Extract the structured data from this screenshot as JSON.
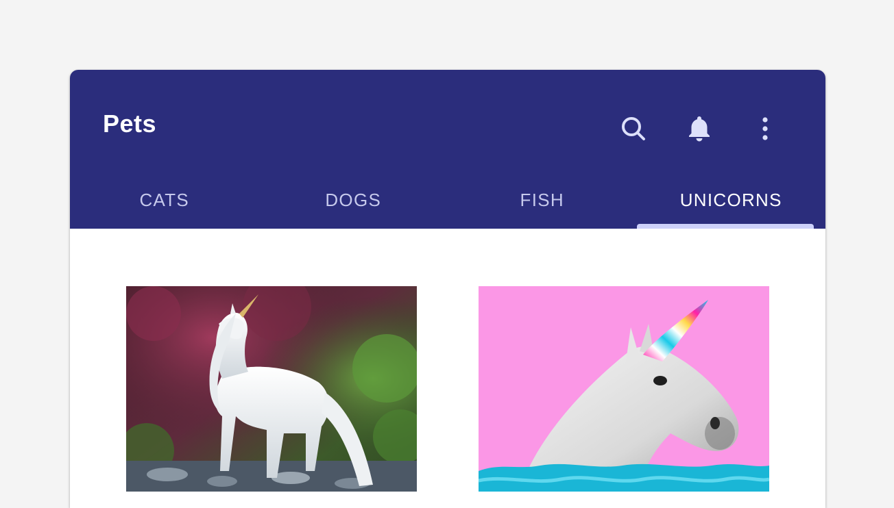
{
  "appbar": {
    "title": "Pets",
    "background": "#2b2d7c",
    "actions": [
      {
        "icon": "search-icon"
      },
      {
        "icon": "bell-icon"
      },
      {
        "icon": "more-vert-icon"
      }
    ]
  },
  "tabs": {
    "items": [
      {
        "label": "CATS"
      },
      {
        "label": "DOGS"
      },
      {
        "label": "FISH"
      },
      {
        "label": "UNICORNS"
      }
    ],
    "selected": "UNICORNS",
    "indicator_color": "#cdd1fa"
  },
  "gallery": {
    "images": [
      {
        "subject": "white unicorn in forest"
      },
      {
        "subject": "white horse with rainbow horn on pink background"
      }
    ],
    "accent_pink": "#fb97e6"
  }
}
